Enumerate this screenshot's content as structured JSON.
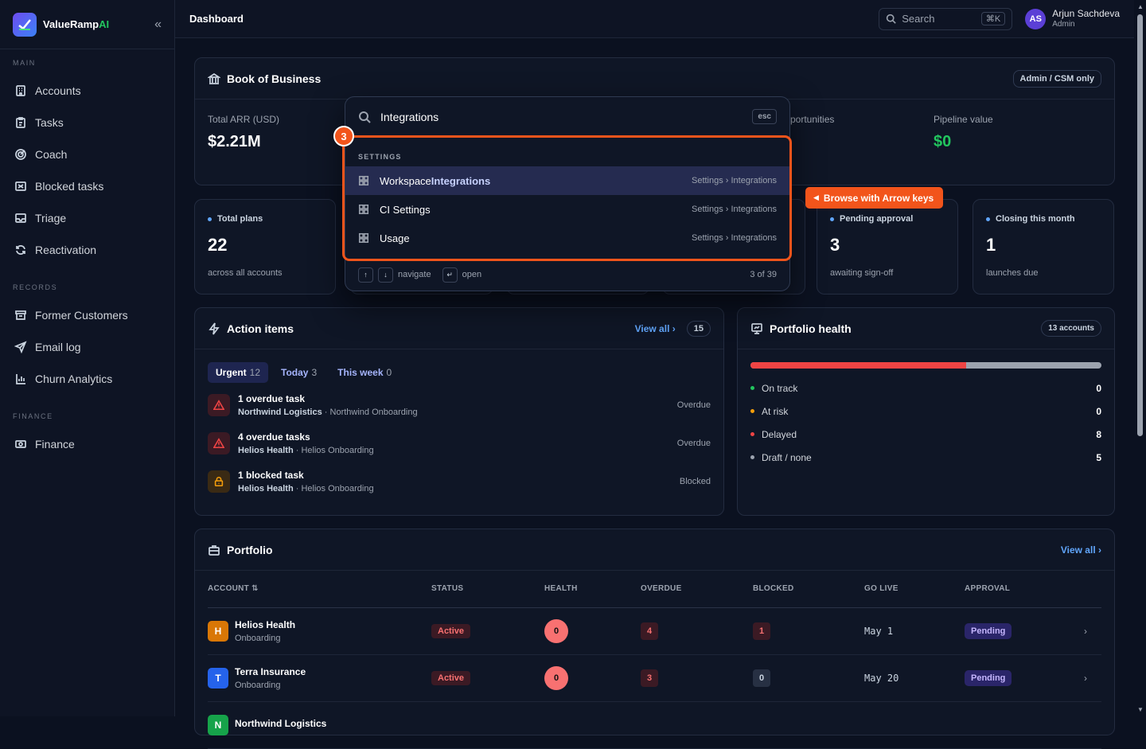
{
  "brand": {
    "name_main": "ValueRamp",
    "name_ai": "AI"
  },
  "sidebar": {
    "sections": [
      {
        "label": "MAIN",
        "items": [
          {
            "label": "Accounts",
            "icon": "building-icon"
          },
          {
            "label": "Tasks",
            "icon": "clipboard-icon"
          },
          {
            "label": "Coach",
            "icon": "target-icon"
          },
          {
            "label": "Blocked tasks",
            "icon": "blocked-icon"
          },
          {
            "label": "Triage",
            "icon": "inbox-icon"
          },
          {
            "label": "Reactivation",
            "icon": "refresh-icon"
          }
        ]
      },
      {
        "label": "RECORDS",
        "items": [
          {
            "label": "Former Customers",
            "icon": "archive-icon"
          },
          {
            "label": "Email log",
            "icon": "send-icon"
          },
          {
            "label": "Churn Analytics",
            "icon": "chart-icon"
          }
        ]
      },
      {
        "label": "FINANCE",
        "items": [
          {
            "label": "Finance",
            "icon": "money-icon"
          }
        ]
      }
    ]
  },
  "topbar": {
    "title": "Dashboard",
    "search_placeholder": "Search",
    "search_shortcut": "⌘K",
    "user_initials": "AS",
    "user_name": "Arjun Sachdeva",
    "user_role": "Admin"
  },
  "book": {
    "title": "Book of Business",
    "badge": "Admin / CSM only",
    "metrics": [
      {
        "label": "Total ARR (USD)",
        "value": "$2.21M"
      },
      {
        "label": "portunities",
        "value": ""
      },
      {
        "label": "Pipeline value",
        "value": "$0"
      }
    ]
  },
  "stats": [
    {
      "title": "Total plans",
      "value": "22",
      "sub": "across all accounts"
    },
    {
      "title": "Pending approval",
      "value": "3",
      "sub": "awaiting sign-off"
    },
    {
      "title": "Closing this month",
      "value": "1",
      "sub": "launches due"
    }
  ],
  "action_items": {
    "title": "Action items",
    "view_all": "View all",
    "count": "15",
    "tabs": [
      {
        "label": "Urgent",
        "count": "12"
      },
      {
        "label": "Today",
        "count": "3"
      },
      {
        "label": "This week",
        "count": "0"
      }
    ],
    "items": [
      {
        "title": "1 overdue task",
        "account": "Northwind Logistics",
        "plan": " · Northwind Onboarding",
        "status": "Overdue",
        "kind": "warning-icon"
      },
      {
        "title": "4 overdue tasks",
        "account": "Helios Health",
        "plan": " · Helios Onboarding",
        "status": "Overdue",
        "kind": "warning-icon"
      },
      {
        "title": "1 blocked task",
        "account": "Helios Health",
        "plan": " · Helios Onboarding",
        "status": "Blocked",
        "kind": "lock-icon"
      }
    ]
  },
  "health": {
    "title": "Portfolio health",
    "badge": "13 accounts",
    "delayed_fraction": 0.615,
    "rows": [
      {
        "label": "On track",
        "value": "0",
        "color": "#22c55e"
      },
      {
        "label": "At risk",
        "value": "0",
        "color": "#f59e0b"
      },
      {
        "label": "Delayed",
        "value": "8",
        "color": "#ef4444"
      },
      {
        "label": "Draft / none",
        "value": "5",
        "color": "#9ca3af"
      }
    ]
  },
  "portfolio": {
    "title": "Portfolio",
    "view_all": "View all",
    "columns": [
      "ACCOUNT ⇅",
      "STATUS",
      "HEALTH",
      "OVERDUE",
      "BLOCKED",
      "GO LIVE",
      "APPROVAL"
    ],
    "rows": [
      {
        "initial": "H",
        "color": "#d97706",
        "name": "Helios Health",
        "stage": "Onboarding",
        "status": "Active",
        "health": "0",
        "overdue": "4",
        "blocked": "1",
        "golive": "May 1",
        "approval": "Pending"
      },
      {
        "initial": "T",
        "color": "#2563eb",
        "name": "Terra Insurance",
        "stage": "Onboarding",
        "status": "Active",
        "health": "0",
        "overdue": "3",
        "blocked": "0",
        "golive": "May 20",
        "approval": "Pending"
      },
      {
        "initial": "N",
        "color": "#16a34a",
        "name": "Northwind Logistics",
        "stage": "",
        "status": "",
        "health": "",
        "overdue": "",
        "blocked": "",
        "golive": "",
        "approval": ""
      }
    ]
  },
  "palette": {
    "query": "Integrations",
    "esc": "esc",
    "section": "SETTINGS",
    "items": [
      {
        "pre": "Workspace ",
        "hit": "Integrations",
        "path": "Settings › Integrations"
      },
      {
        "pre": "CI Settings",
        "hit": "",
        "path": "Settings › Integrations"
      },
      {
        "pre": "Usage",
        "hit": "",
        "path": "Settings › Integrations"
      }
    ],
    "hint_navigate": "navigate",
    "hint_open": "open",
    "position": "3 of 39"
  },
  "tour": {
    "step": "3",
    "tooltip": "Browse with Arrow keys"
  }
}
